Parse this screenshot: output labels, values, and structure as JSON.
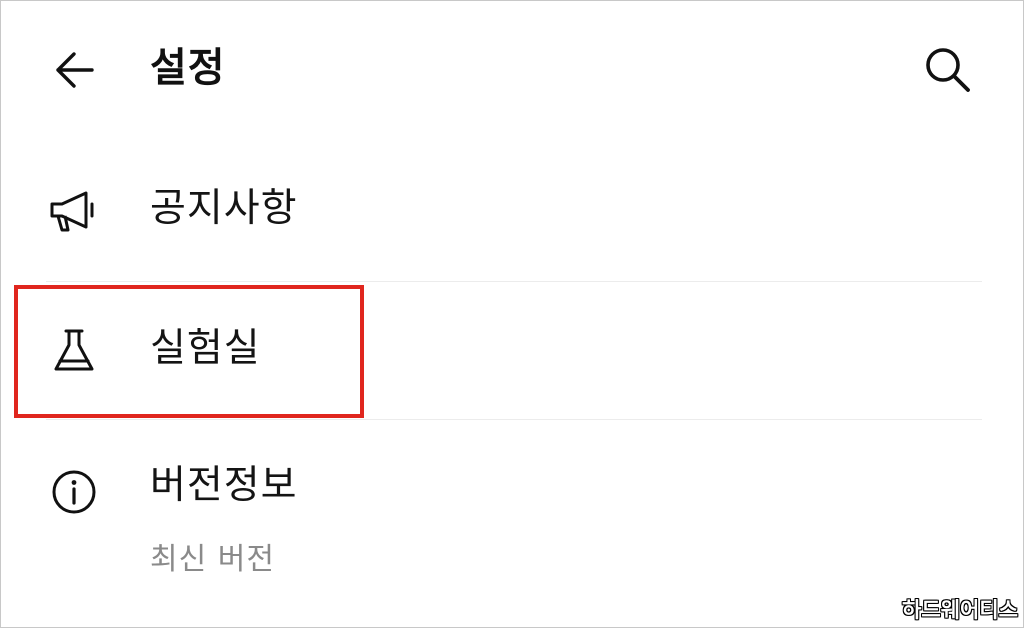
{
  "header": {
    "title": "설정"
  },
  "menu": {
    "items": [
      {
        "label": "공지사항",
        "icon": "megaphone-icon"
      },
      {
        "label": "실험실",
        "icon": "flask-icon",
        "highlighted": true
      },
      {
        "label": "버전정보",
        "icon": "info-icon",
        "subtitle": "최신 버전"
      }
    ]
  },
  "watermark": "하드웨어티스",
  "colors": {
    "highlight": "#e0261e",
    "text": "#141414",
    "subtext": "#8a8a8a"
  }
}
